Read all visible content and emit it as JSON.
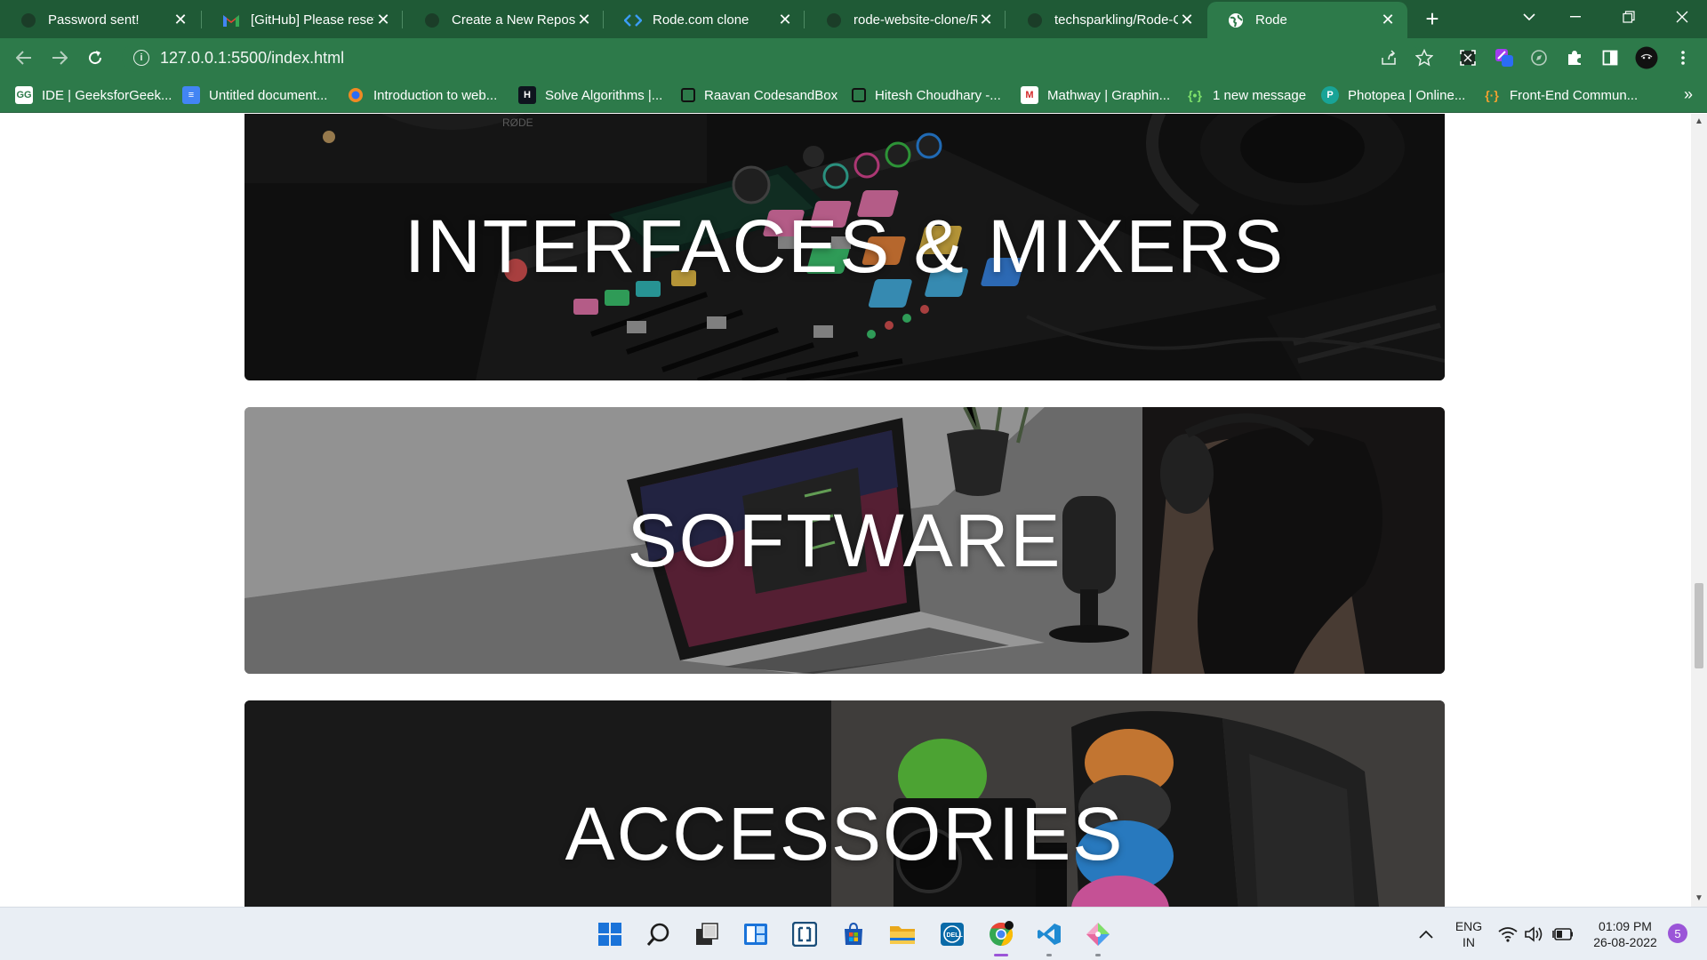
{
  "tabs": [
    {
      "title": "Password sent!",
      "icon": "github-icon"
    },
    {
      "title": "[GitHub] Please reset",
      "icon": "gmail-icon"
    },
    {
      "title": "Create a New Reposit",
      "icon": "github-icon"
    },
    {
      "title": "Rode.com clone",
      "icon": "code-icon"
    },
    {
      "title": "rode-website-clone/R",
      "icon": "github-icon"
    },
    {
      "title": "techsparkling/Rode-C",
      "icon": "github-icon"
    },
    {
      "title": "Rode",
      "icon": "globe-icon",
      "active": true
    }
  ],
  "address_bar": {
    "url": "127.0.0.1:5500/index.html"
  },
  "bookmarks": [
    {
      "label": "IDE | GeeksforGeek...",
      "icon": "gfg-icon"
    },
    {
      "label": "Untitled document...",
      "icon": "docs-icon"
    },
    {
      "label": "Introduction to web...",
      "icon": "web-icon"
    },
    {
      "label": "Solve Algorithms |...",
      "icon": "hackerrank-icon"
    },
    {
      "label": "Raavan CodesandBox",
      "icon": "codesandbox-icon"
    },
    {
      "label": "Hitesh Choudhary -...",
      "icon": "codesandbox-icon"
    },
    {
      "label": "Mathway | Graphin...",
      "icon": "mathway-icon"
    },
    {
      "label": "1 new message",
      "icon": "chat-icon"
    },
    {
      "label": "Photopea | Online...",
      "icon": "photopea-icon"
    },
    {
      "label": "Front-End Commun...",
      "icon": "frontend-icon"
    }
  ],
  "page": {
    "cards": [
      {
        "label": "INTERFACES & MIXERS"
      },
      {
        "label": "SOFTWARE"
      },
      {
        "label": "ACCESSORIES"
      }
    ]
  },
  "taskbar": {
    "apps": [
      "windows-start-icon",
      "search-icon",
      "task-view-icon",
      "widgets-icon",
      "terminal-icon",
      "store-icon",
      "file-explorer-icon",
      "dell-icon",
      "chrome-icon",
      "vscode-icon",
      "git-icon"
    ],
    "language": {
      "line1": "ENG",
      "line2": "IN"
    },
    "time": "01:09 PM",
    "date": "26-08-2022",
    "notification_count": "5"
  },
  "colors": {
    "browser_frame": "#1f5a36",
    "toolbar": "#2d7a4a",
    "taskbar": "#e9eef4"
  }
}
